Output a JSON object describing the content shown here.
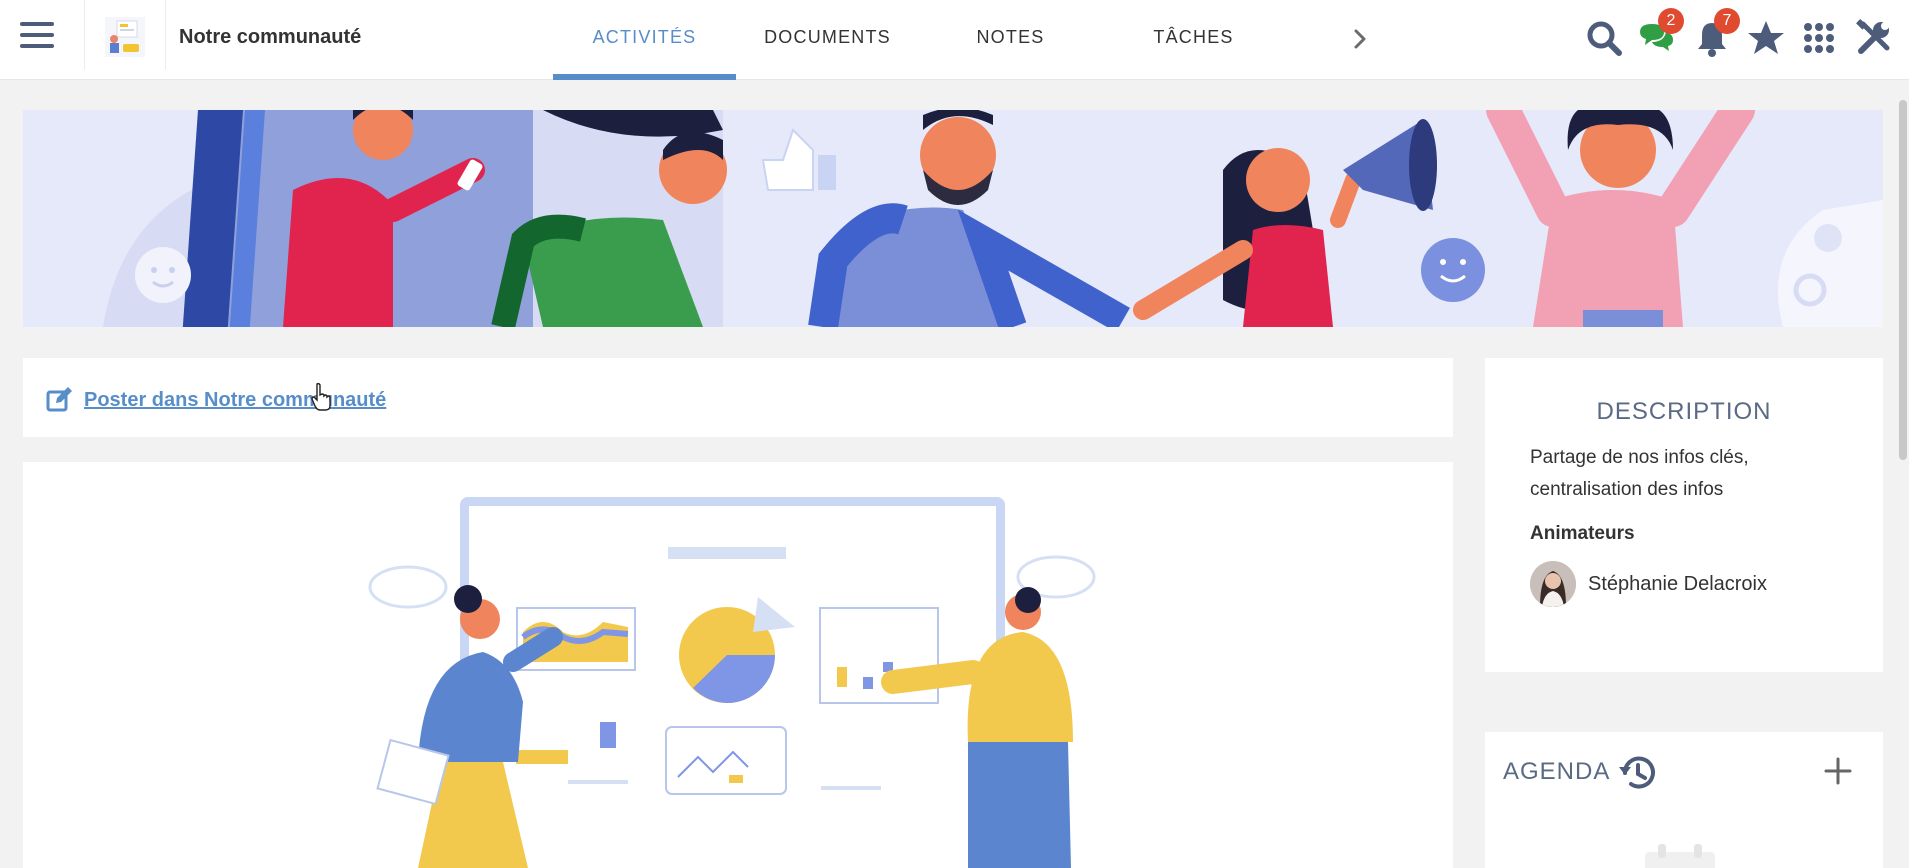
{
  "header": {
    "space_name": "Notre communauté",
    "tabs": [
      {
        "label": "ACTIVITÉS",
        "active": true
      },
      {
        "label": "DOCUMENTS",
        "active": false
      },
      {
        "label": "NOTES",
        "active": false
      },
      {
        "label": "TÂCHES",
        "active": false
      }
    ],
    "icons": [
      "hamburger-icon",
      "search-icon",
      "chat-icon",
      "bell-icon",
      "star-icon",
      "apps-grid-icon",
      "tools-icon",
      "chevron-right-icon"
    ],
    "chat_badge": "2",
    "notifications_badge": "7"
  },
  "composer": {
    "label": "Poster dans Notre communauté"
  },
  "description": {
    "title": "DESCRIPTION",
    "text": "Partage de nos infos clés, centralisation des infos",
    "managers_title": "Animateurs",
    "manager_name": "Stéphanie Delacroix"
  },
  "agenda": {
    "title": "AGENDA"
  },
  "colors": {
    "accent": "#578dc9",
    "badge": "#e04a2f",
    "icon": "#4d5c7a",
    "title_grey": "#5a6a85"
  }
}
